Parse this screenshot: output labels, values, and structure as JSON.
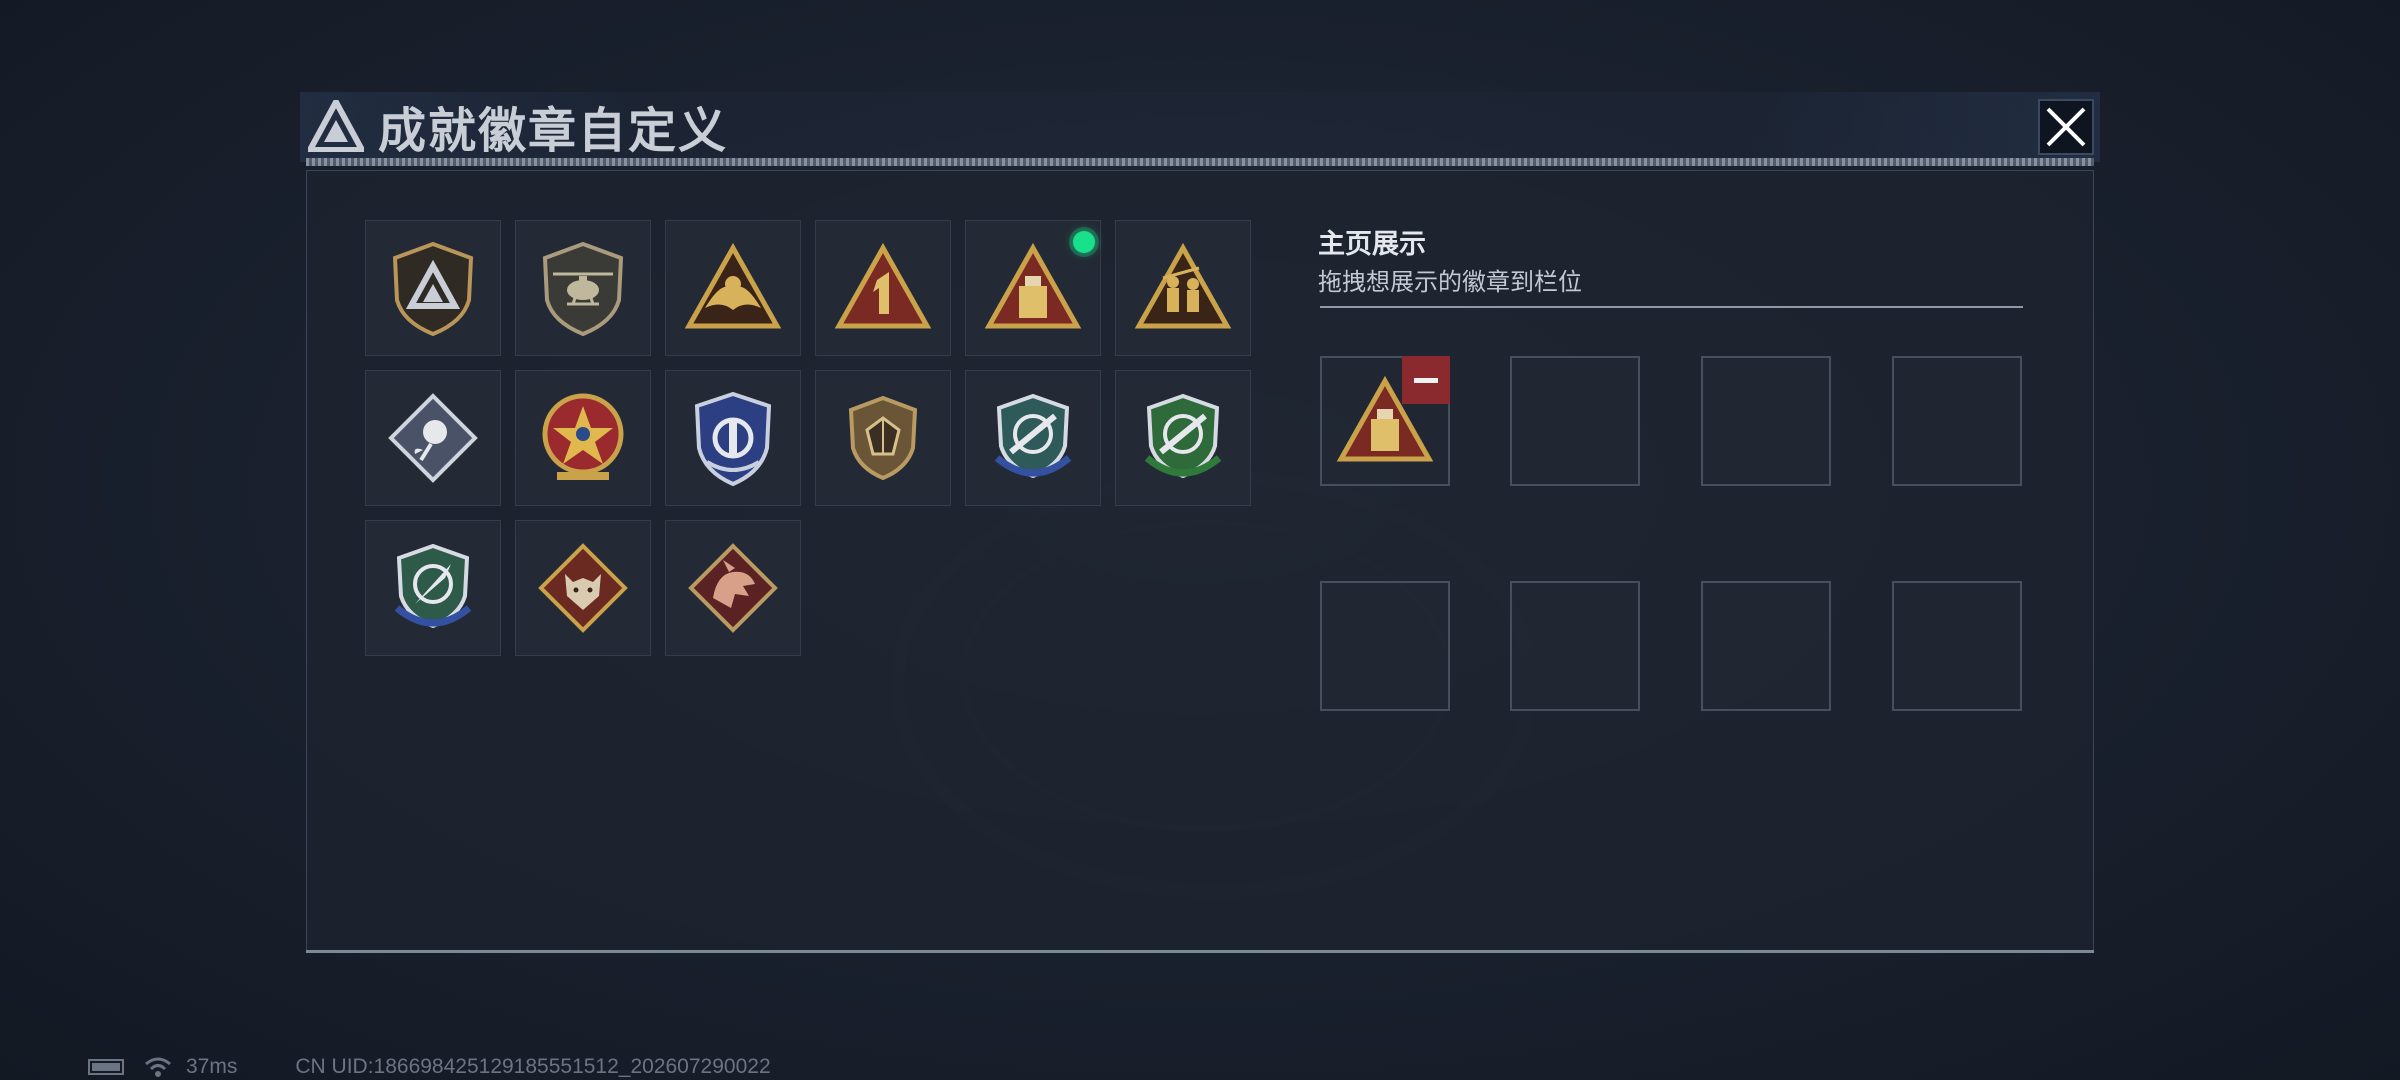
{
  "window": {
    "title": "成就徽章自定义"
  },
  "badges": [
    {
      "icon": "triangle-logo-shield-badge",
      "equipped": false
    },
    {
      "icon": "helicopter-shield-badge",
      "equipped": false
    },
    {
      "icon": "golden-wings-triangle-badge",
      "equipped": false
    },
    {
      "icon": "number-one-triangle-badge",
      "equipped": false
    },
    {
      "icon": "usb-drive-triangle-badge",
      "equipped": true
    },
    {
      "icon": "soldiers-triangle-badge",
      "equipped": false
    },
    {
      "icon": "rose-diamond-badge",
      "equipped": false
    },
    {
      "icon": "star-compass-medal-badge",
      "equipped": false
    },
    {
      "icon": "blue-eagle-shield-badge",
      "equipped": false
    },
    {
      "icon": "gem-shield-badge",
      "equipped": false
    },
    {
      "icon": "rifle-crosshair-blue-badge",
      "equipped": false
    },
    {
      "icon": "rifle-crosshair-green-badge",
      "equipped": false
    },
    {
      "icon": "knife-crosshair-badge",
      "equipped": false
    },
    {
      "icon": "wolf-diamond-badge",
      "equipped": false
    },
    {
      "icon": "dragon-diamond-badge",
      "equipped": false
    }
  ],
  "showcase": {
    "title": "主页展示",
    "subtitle": "拖拽想展示的徽章到栏位",
    "slots": [
      {
        "badge": "usb-drive-triangle-badge",
        "removable": true
      },
      {
        "badge": null
      },
      {
        "badge": null
      },
      {
        "badge": null
      },
      {
        "badge": null
      },
      {
        "badge": null
      },
      {
        "badge": null
      },
      {
        "badge": null
      }
    ]
  },
  "status": {
    "ping": "37ms",
    "uid": "CN UID:18669842512918555151​2_202607290022"
  },
  "colors": {
    "equipped": "#19e08a",
    "remove": "#8a2a2e",
    "gold": "#c9a24a"
  }
}
